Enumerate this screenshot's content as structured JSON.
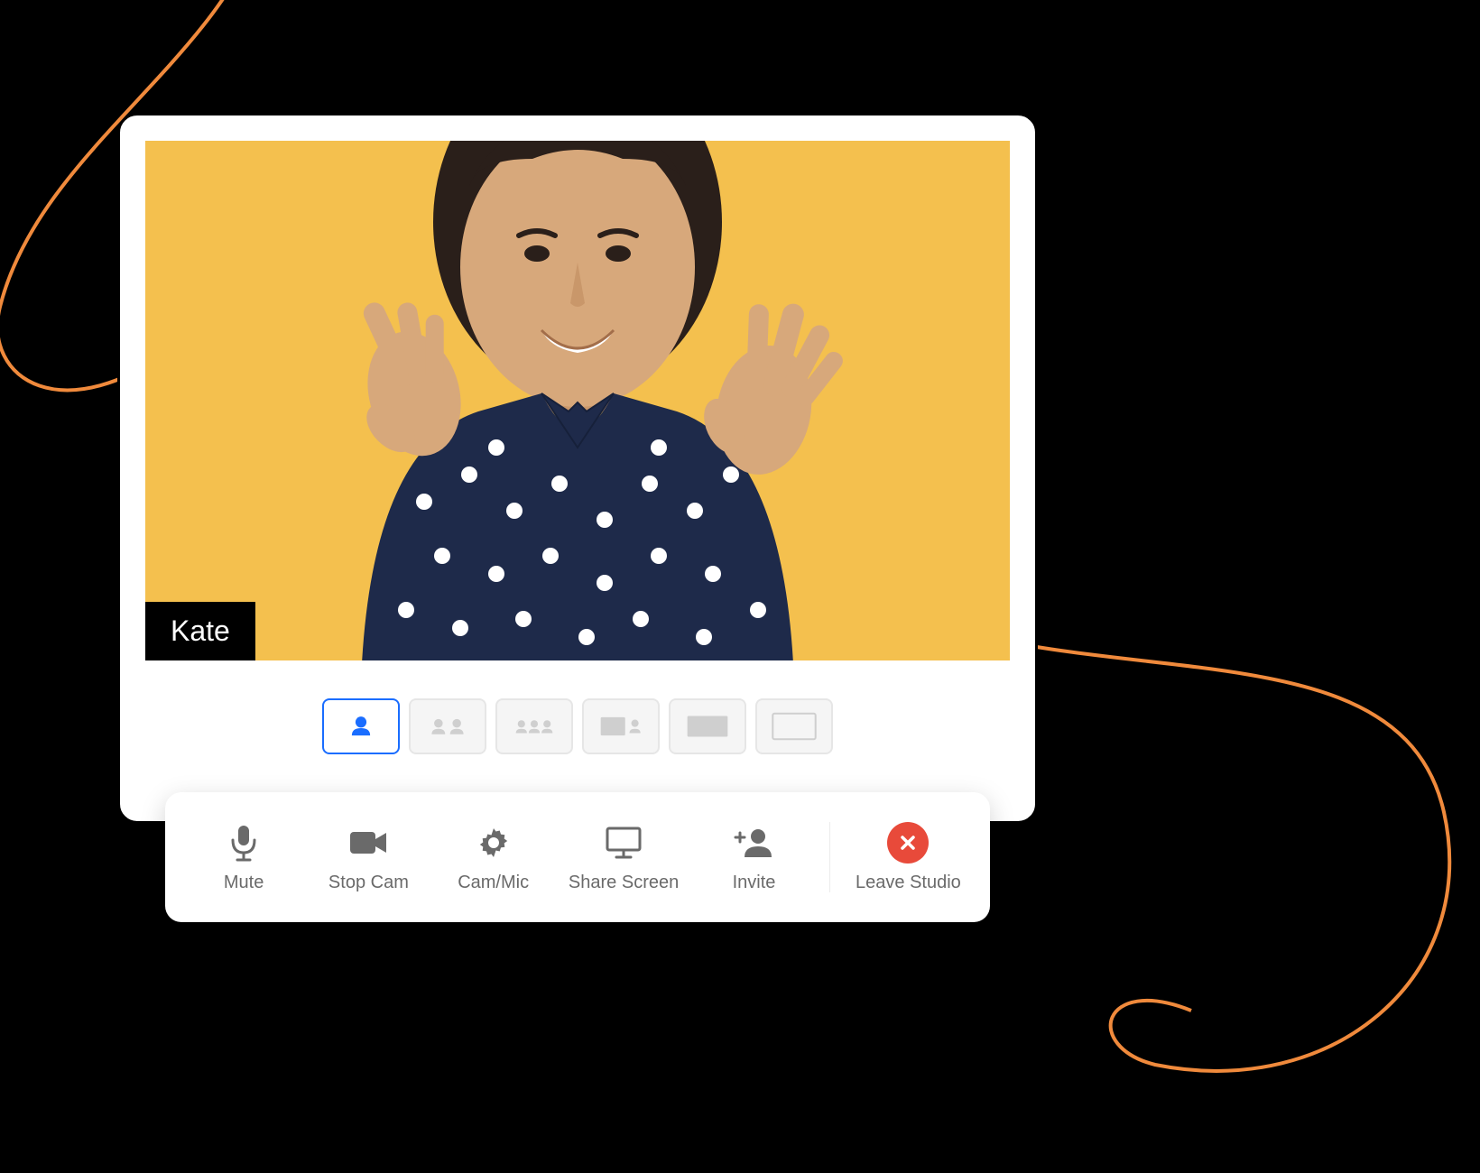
{
  "participant": {
    "name": "Kate"
  },
  "controls": {
    "mute": "Mute",
    "stop_cam": "Stop Cam",
    "cam_mic": "Cam/Mic",
    "share_screen": "Share Screen",
    "invite": "Invite",
    "leave": "Leave Studio"
  },
  "colors": {
    "accent": "#1a6dff",
    "video_bg": "#f4c04e",
    "leave": "#e84a3a",
    "curve": "#f08a3c"
  }
}
